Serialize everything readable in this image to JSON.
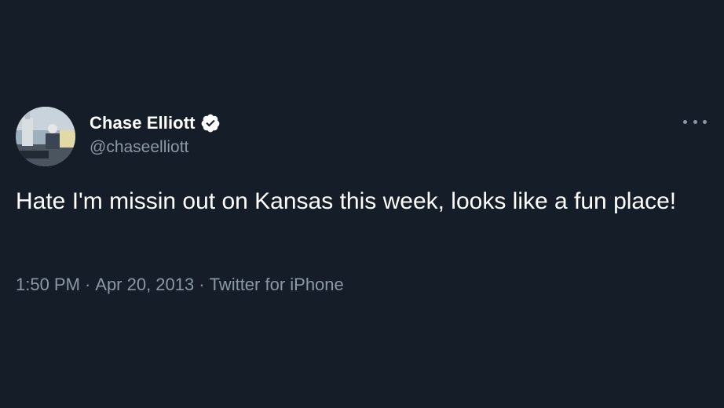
{
  "tweet": {
    "author": {
      "display_name": "Chase Elliott",
      "handle": "@chaseelliott",
      "verified": true,
      "avatar_icon": "profile-photo"
    },
    "more_icon": "more-horizontal-icon",
    "text": "Hate I'm missin out on Kansas this week, looks like a fun place!",
    "time": "1:50 PM",
    "date": "Apr 20, 2013",
    "source": "Twitter for iPhone",
    "separator": "·"
  },
  "colors": {
    "background": "#151d28",
    "primary_text": "#ffffff",
    "secondary_text": "#8b98a5",
    "verified_badge": "#ffffff"
  }
}
